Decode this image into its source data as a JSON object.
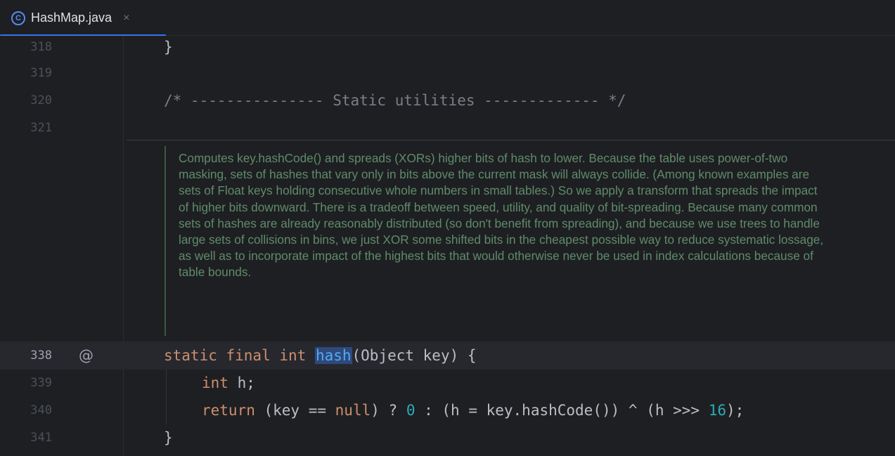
{
  "tab": {
    "icon": "C",
    "title": "HashMap.java",
    "close": "×"
  },
  "lines": [
    {
      "num": "318",
      "code": "}"
    },
    {
      "num": "319",
      "code": ""
    },
    {
      "num": "320",
      "code": "/* --------------- Static utilities ------------- */"
    },
    {
      "num": "321",
      "code": ""
    },
    {
      "num": "338",
      "gutter_icon": "@"
    },
    {
      "num": "339"
    },
    {
      "num": "340"
    },
    {
      "num": "341",
      "code": "}"
    }
  ],
  "doc_comment": "Computes key.hashCode() and spreads (XORs) higher bits of hash to lower. Because the table uses power-of-two masking, sets of hashes that vary only in bits above the current mask will always collide. (Among known examples are sets of Float keys holding consecutive whole numbers in small tables.) So we apply a transform that spreads the impact of higher bits downward. There is a tradeoff between speed, utility, and quality of bit-spreading. Because many common sets of hashes are already reasonably distributed (so don't benefit from spreading), and because we use trees to handle large sets of collisions in bins, we just XOR some shifted bits in the cheapest possible way to reduce systematic lossage, as well as to incorporate impact of the highest bits that would otherwise never be used in index calculations because of table bounds.",
  "code338": {
    "kw1": "static final int ",
    "fn": "hash",
    "rest": "(Object key) {"
  },
  "code339": {
    "kw": "int",
    "rest": " h;"
  },
  "code340": {
    "kw": "return",
    "p1": " (key == ",
    "null": "null",
    "p2": ") ? ",
    "zero": "0",
    "p3": " : (h = key.hashCode()) ^ (h >>> ",
    "sixteen": "16",
    "p4": ");"
  },
  "colors": {
    "keyword": "#cf8e6d",
    "number": "#2aacb8",
    "comment": "#7a7e85",
    "doc_comment": "#5f8c6a",
    "tab_accent": "#3574f0"
  }
}
